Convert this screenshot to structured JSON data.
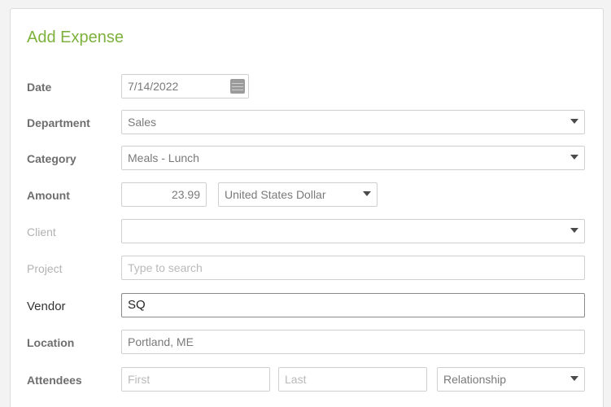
{
  "form": {
    "title": "Add Expense",
    "date": {
      "label": "Date",
      "value": "7/14/2022",
      "icon": "calendar-icon"
    },
    "department": {
      "label": "Department",
      "value": "Sales"
    },
    "category": {
      "label": "Category",
      "value": "Meals - Lunch"
    },
    "amount": {
      "label": "Amount",
      "value": "23.99",
      "currency": "United States Dollar"
    },
    "client": {
      "label": "Client",
      "value": ""
    },
    "project": {
      "label": "Project",
      "placeholder": "Type to search"
    },
    "vendor": {
      "label": "Vendor",
      "value": "SQ"
    },
    "location": {
      "label": "Location",
      "value": "Portland, ME"
    },
    "attendees": {
      "label": "Attendees",
      "first_placeholder": "First",
      "last_placeholder": "Last",
      "relationship": "Relationship"
    }
  },
  "colors": {
    "accent": "#7db13d"
  }
}
